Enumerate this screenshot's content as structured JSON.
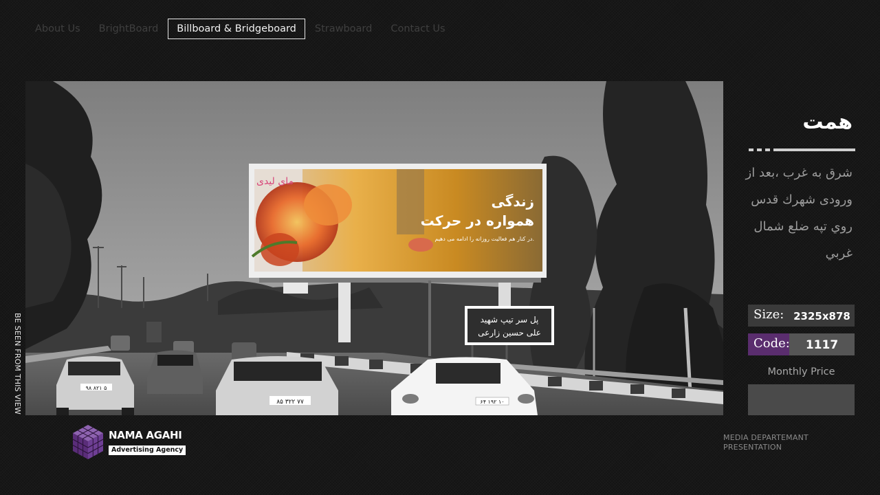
{
  "nav": {
    "items": [
      {
        "label": "About Us",
        "active": false
      },
      {
        "label": "BrightBoard",
        "active": false
      },
      {
        "label": "Billboard & Bridgeboard",
        "active": true
      },
      {
        "label": "Strawboard",
        "active": false
      },
      {
        "label": "Contact Us",
        "active": false
      }
    ]
  },
  "photo": {
    "billboard": {
      "brand": "مای لیدی",
      "headline_1": "زندگی",
      "headline_2": "همواره در حرکت",
      "tagline": "در کنار هم فعالیت روزانه را ادامه می دهیم."
    },
    "road_sign": {
      "line_1": "پل سر تیپ شهید",
      "line_2": "علی حسین زارعی"
    },
    "plates": [
      "۹۸ ۸۲۱ ۵",
      "۸۵ ۳۲۲ ۷۷",
      "۶۴ ۱۹۲ ۱۰"
    ]
  },
  "side_caption": "BE SEEN FROM THIS VIEW",
  "location": {
    "title": "همت",
    "description": "شرق به غرب ،بعد از ورودی شهرك قدس روي تپه ضلع شمال غربي"
  },
  "specs": {
    "size_label": "Size:",
    "size_value": "2325x878",
    "code_label": "Code:",
    "code_value": "1117",
    "price_label": "Monthly Price",
    "price_value": ""
  },
  "footer": {
    "logo_name": "NAMA AGAHI",
    "logo_sub": "Advertising Agency",
    "note_1": "MEDIA DEPARTEMANT",
    "note_2": "PRESENTATION"
  },
  "colors": {
    "background": "#141414",
    "accent_purple": "#5a2d6e",
    "spec_box": "#3a3a3a"
  }
}
